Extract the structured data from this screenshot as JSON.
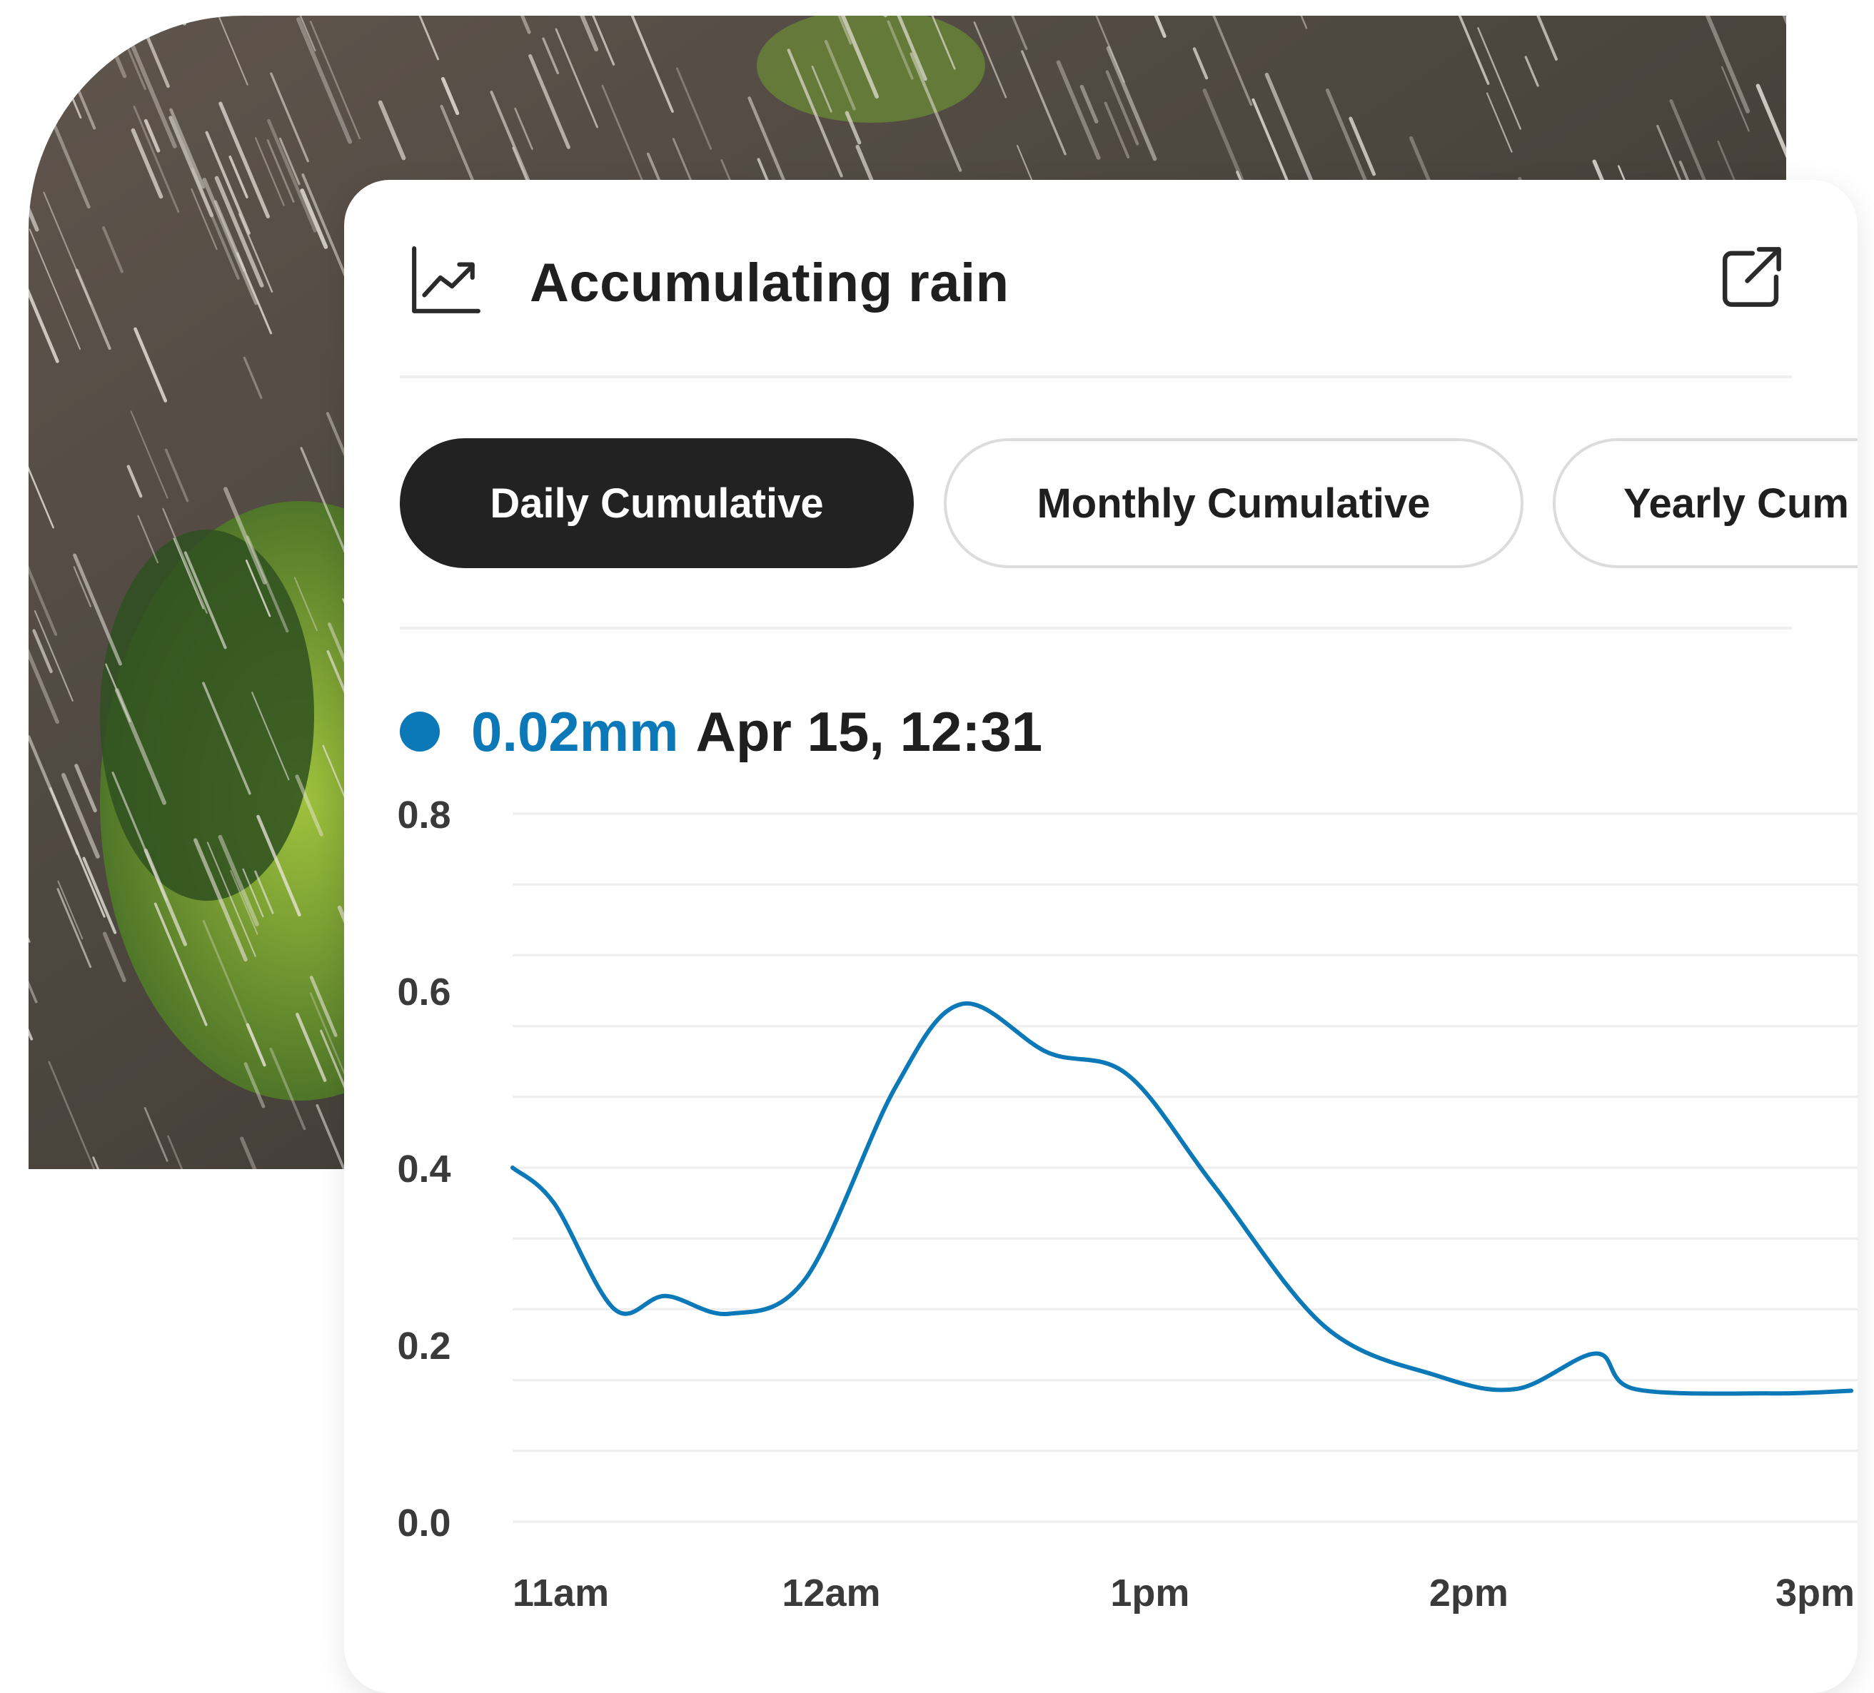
{
  "card": {
    "title": "Accumulating rain",
    "tabs": [
      {
        "label": "Daily Cumulative",
        "active": true
      },
      {
        "label": "Monthly Cumulative",
        "active": false
      },
      {
        "label": "Yearly Cum",
        "active": false
      }
    ],
    "readout": {
      "value": "0.02mm",
      "timestamp": "Apr 15, 12:31"
    }
  },
  "colors": {
    "accent": "#0b79b8",
    "active_tab": "#222222",
    "grid": "#eeeeee"
  },
  "icons": [
    "trend-chart-icon",
    "external-link-icon"
  ],
  "chart_data": {
    "type": "line",
    "x_tick_labels": [
      "11am",
      "12am",
      "1pm",
      "2pm",
      "3pm"
    ],
    "y_tick_labels": [
      "0.8",
      "0.6",
      "0.4",
      "0.2",
      "0.0"
    ],
    "ylim": [
      0,
      0.8
    ],
    "grid": true,
    "series": [
      {
        "color": "#0b79b8",
        "points": [
          [
            11.0,
            0.4
          ],
          [
            11.13,
            0.36
          ],
          [
            11.32,
            0.24
          ],
          [
            11.48,
            0.255
          ],
          [
            11.68,
            0.235
          ],
          [
            11.92,
            0.275
          ],
          [
            12.2,
            0.49
          ],
          [
            12.41,
            0.585
          ],
          [
            12.68,
            0.53
          ],
          [
            12.93,
            0.505
          ],
          [
            13.2,
            0.38
          ],
          [
            13.55,
            0.22
          ],
          [
            13.9,
            0.165
          ],
          [
            14.15,
            0.15
          ],
          [
            14.4,
            0.19
          ],
          [
            14.52,
            0.15
          ],
          [
            14.95,
            0.145
          ],
          [
            15.2,
            0.148
          ]
        ]
      }
    ]
  }
}
